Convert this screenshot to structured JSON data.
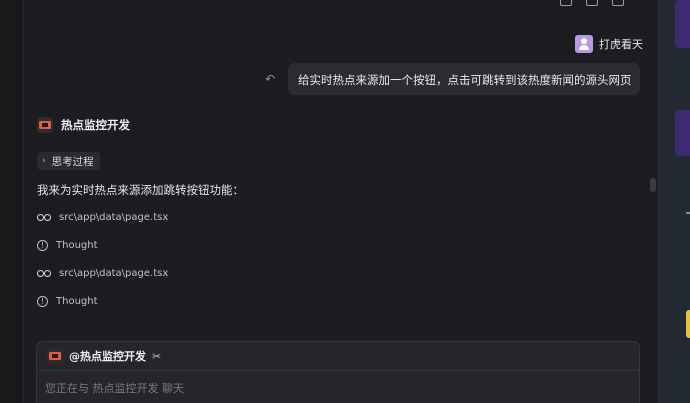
{
  "user": {
    "name": "打虎看天",
    "message": "给实时热点来源加一个按钮，点击可跳转到该热度新闻的源头网页"
  },
  "agent": {
    "name": "热点监控开发",
    "thinking_label": "思考过程",
    "intro": "我来为实时热点来源添加跳转按钮功能：",
    "steps": [
      {
        "icon": "glasses-icon",
        "label": "src\\app\\data\\page.tsx"
      },
      {
        "icon": "info-icon",
        "label": "Thought"
      },
      {
        "icon": "glasses-icon",
        "label": "src\\app\\data\\page.tsx"
      },
      {
        "icon": "info-icon",
        "label": "Thought"
      }
    ]
  },
  "composer": {
    "mention": "@热点监控开发",
    "placeholder": "您正在与 热点监控开发 聊天"
  },
  "colors": {
    "background": "#1c1d21",
    "bubble": "#2b2c31",
    "avatar": "#b998e6",
    "agent_logo": "#e35b3a",
    "right_accent_purple": "#3c2b72",
    "right_accent_yellow": "#e7c23d"
  }
}
